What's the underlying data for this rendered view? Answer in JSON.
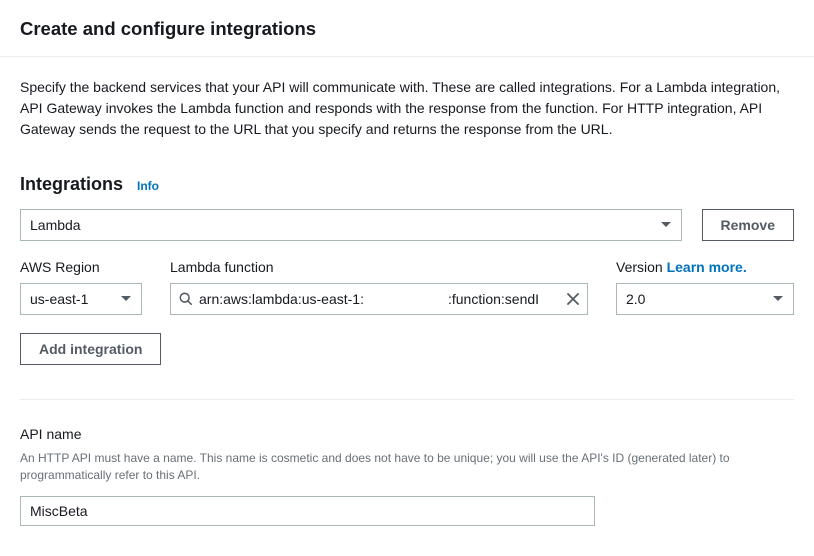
{
  "header": {
    "title": "Create and configure integrations"
  },
  "intro_text": "Specify the backend services that your API will communicate with. These are called integrations. For a Lambda integration, API Gateway invokes the Lambda function and responds with the response from the function. For HTTP integration, API Gateway sends the request to the URL that you specify and returns the response from the URL.",
  "integrations": {
    "heading": "Integrations",
    "info": "Info",
    "type_selected": "Lambda",
    "remove_label": "Remove",
    "region_label": "AWS Region",
    "region_value": "us-east-1",
    "lambda_label": "Lambda function",
    "lambda_arn_prefix": "arn:aws:lambda:us-east-1:",
    "lambda_arn_suffix": ":function:sendI",
    "version_label": "Version",
    "learn_more": "Learn more.",
    "version_value": "2.0",
    "add_label": "Add integration"
  },
  "api_name": {
    "label": "API name",
    "help": "An HTTP API must have a name. This name is cosmetic and does not have to be unique; you will use the API's ID (generated later) to programmatically refer to this API.",
    "value": "MiscBeta"
  },
  "icons": {
    "search": "search-icon",
    "clear": "clear-icon",
    "caret": "caret-icon"
  }
}
